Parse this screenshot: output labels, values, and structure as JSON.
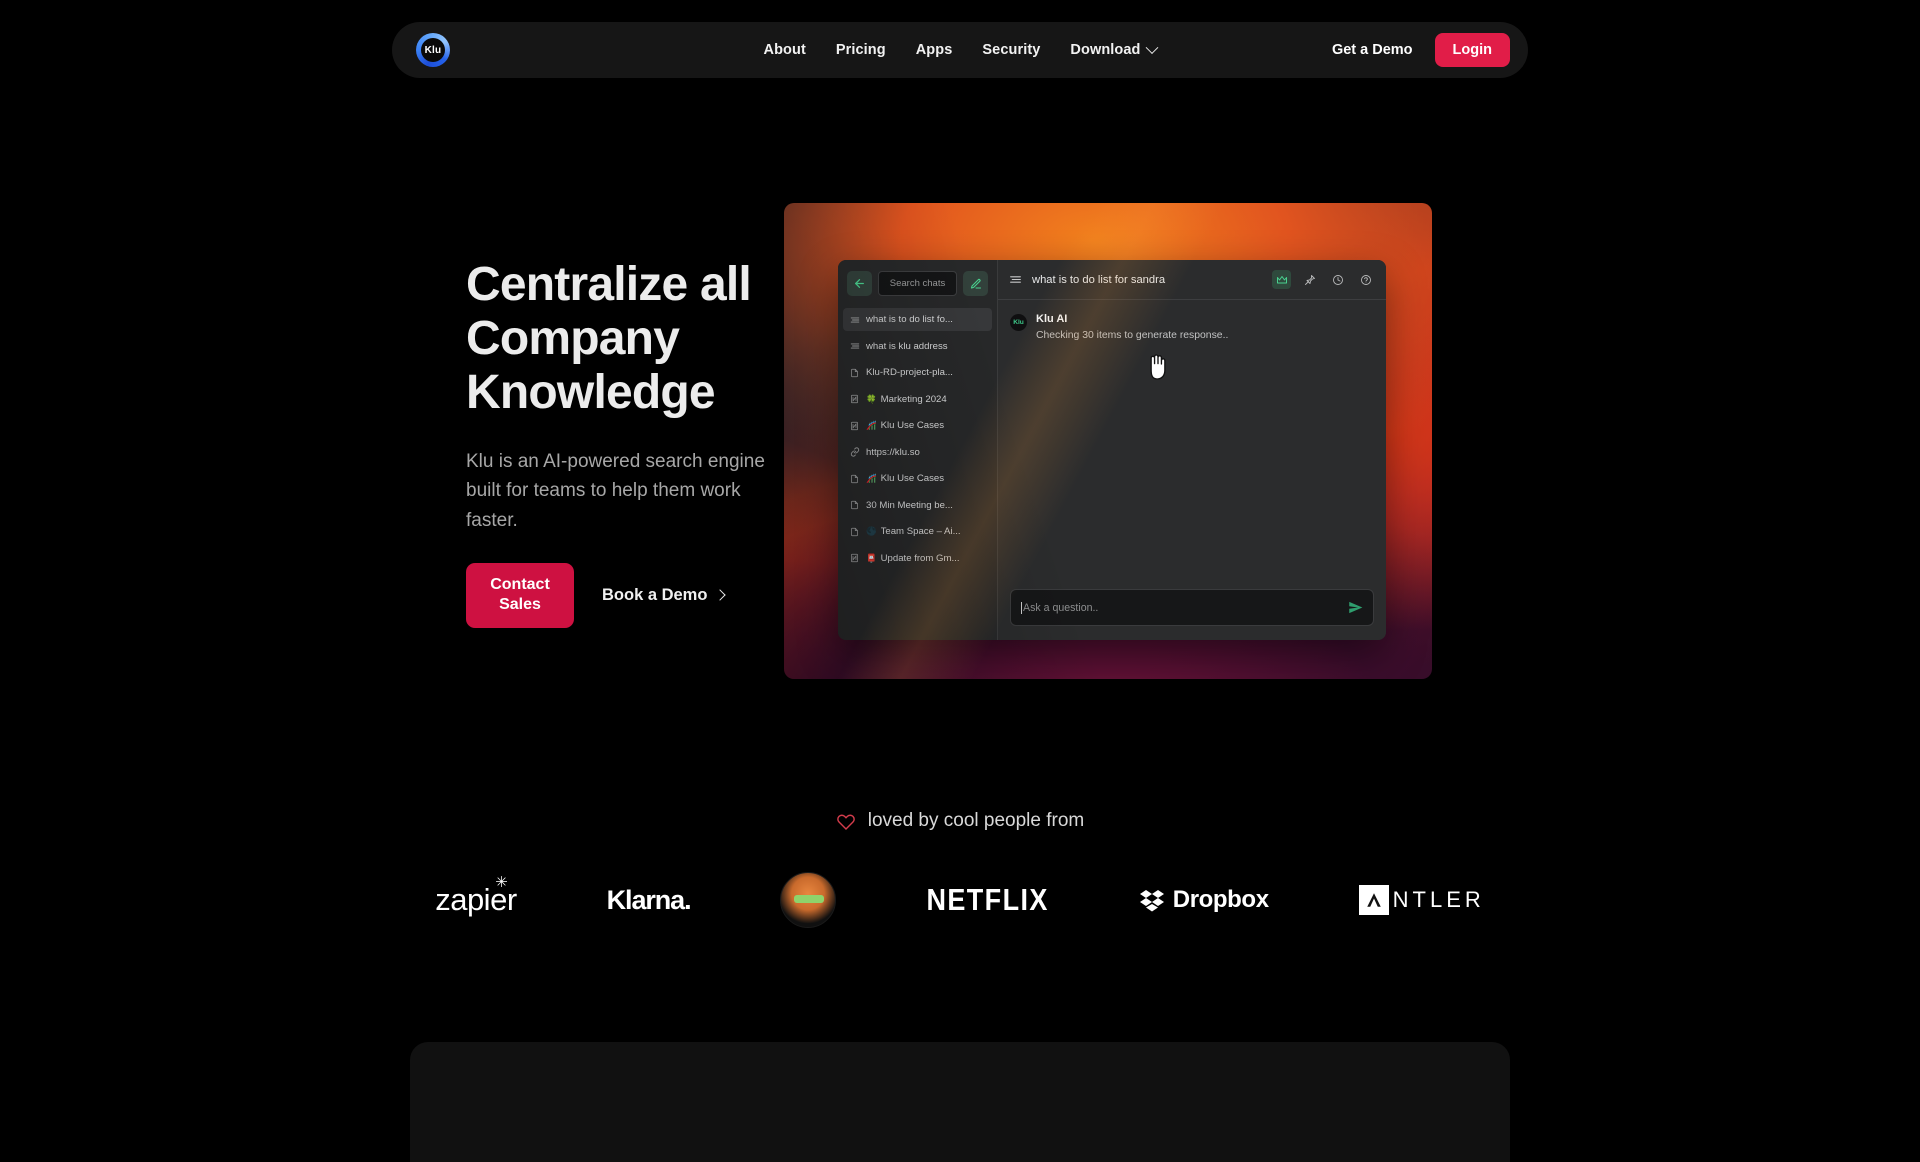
{
  "brand": {
    "logo_text": "Klu",
    "accent_red": "#E11D48",
    "accent_green": "#49d18f"
  },
  "navbar": {
    "links": [
      {
        "label": "About",
        "name": "nav-link-about"
      },
      {
        "label": "Pricing",
        "name": "nav-link-pricing"
      },
      {
        "label": "Apps",
        "name": "nav-link-apps"
      },
      {
        "label": "Security",
        "name": "nav-link-security"
      }
    ],
    "dropdown_label": "Download",
    "get_demo_label": "Get a Demo",
    "login_label": "Login"
  },
  "hero": {
    "title_line1": "Centralize all",
    "title_line2": "Company",
    "title_line3": "Knowledge",
    "subtitle": "Klu is an AI-powered search engine built for teams to help them work faster.",
    "primary_cta": "Contact Sales",
    "secondary_cta": "Book a Demo"
  },
  "app_mockup": {
    "sidebar": {
      "back_icon": "arrow-left-icon",
      "search_placeholder": "Search chats",
      "compose_icon": "compose-pencil-icon",
      "items": [
        {
          "icon": "chat-lines-icon",
          "emoji": "",
          "label": "what is to do list fo...",
          "active": true
        },
        {
          "icon": "chat-lines-icon",
          "emoji": "",
          "label": "what is klu address",
          "active": false
        },
        {
          "icon": "document-icon",
          "emoji": "",
          "label": "Klu-RD-project-pla...",
          "active": false
        },
        {
          "icon": "notion-icon",
          "emoji": "🍀",
          "label": "Marketing 2024",
          "active": false
        },
        {
          "icon": "notion-icon",
          "emoji": "🎢",
          "label": "Klu Use Cases",
          "active": false
        },
        {
          "icon": "link-icon",
          "emoji": "",
          "label": "https://klu.so",
          "active": false
        },
        {
          "icon": "document-icon",
          "emoji": "🎢",
          "label": "Klu Use Cases",
          "active": false
        },
        {
          "icon": "document-icon",
          "emoji": "",
          "label": "30 Min Meeting be...",
          "active": false
        },
        {
          "icon": "document-icon",
          "emoji": "🌑",
          "label": "Team Space – Ai...",
          "active": false
        },
        {
          "icon": "notion-icon",
          "emoji": "📮",
          "label": "Update from Gm...",
          "active": false
        }
      ]
    },
    "chat": {
      "menu_icon": "hamburger-icon",
      "title": "what is to do list for sandra",
      "header_icons": [
        {
          "name": "crown-icon",
          "active": true
        },
        {
          "name": "pin-icon",
          "active": false
        },
        {
          "name": "history-clock-icon",
          "active": false
        },
        {
          "name": "help-circle-icon",
          "active": false
        }
      ],
      "message": {
        "avatar_text": "Klu",
        "author": "Klu AI",
        "body": "Checking 30 items to generate response.."
      },
      "input_placeholder": "Ask a question..",
      "send_icon": "send-paper-plane-icon"
    }
  },
  "social_proof": {
    "heart_icon": "heart-icon",
    "headline": "loved by cool people from",
    "logos": [
      {
        "name": "zapier-logo",
        "label": "zapier"
      },
      {
        "name": "klarna-logo",
        "label": "Klarna."
      },
      {
        "name": "cat-logo",
        "label": ""
      },
      {
        "name": "netflix-logo",
        "label": "NETFLIX"
      },
      {
        "name": "dropbox-logo",
        "label": "Dropbox"
      },
      {
        "name": "antler-logo",
        "label": "NTLER"
      }
    ]
  }
}
